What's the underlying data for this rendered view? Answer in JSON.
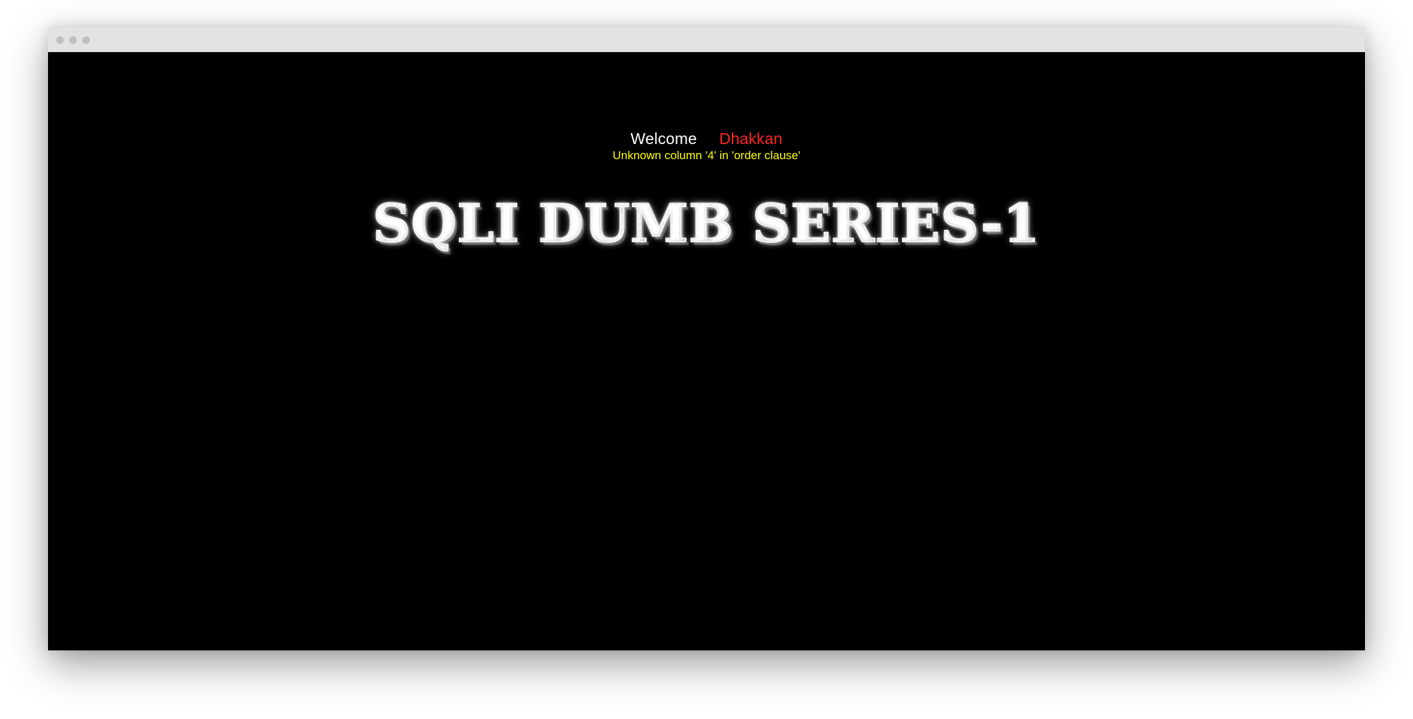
{
  "window": {
    "controls": [
      "window-control-1",
      "window-control-2",
      "window-control-3"
    ]
  },
  "page": {
    "welcome_label": "Welcome",
    "username": "Dhakkan",
    "error_message": "Unknown column '4' in 'order clause'",
    "title_logo": "SQLI DUMB SERIES-1"
  },
  "colors": {
    "background": "#000000",
    "welcome": "#ffffff",
    "username": "#ff2424",
    "error": "#ffff00",
    "title_stroke": "#f3f3f3"
  }
}
